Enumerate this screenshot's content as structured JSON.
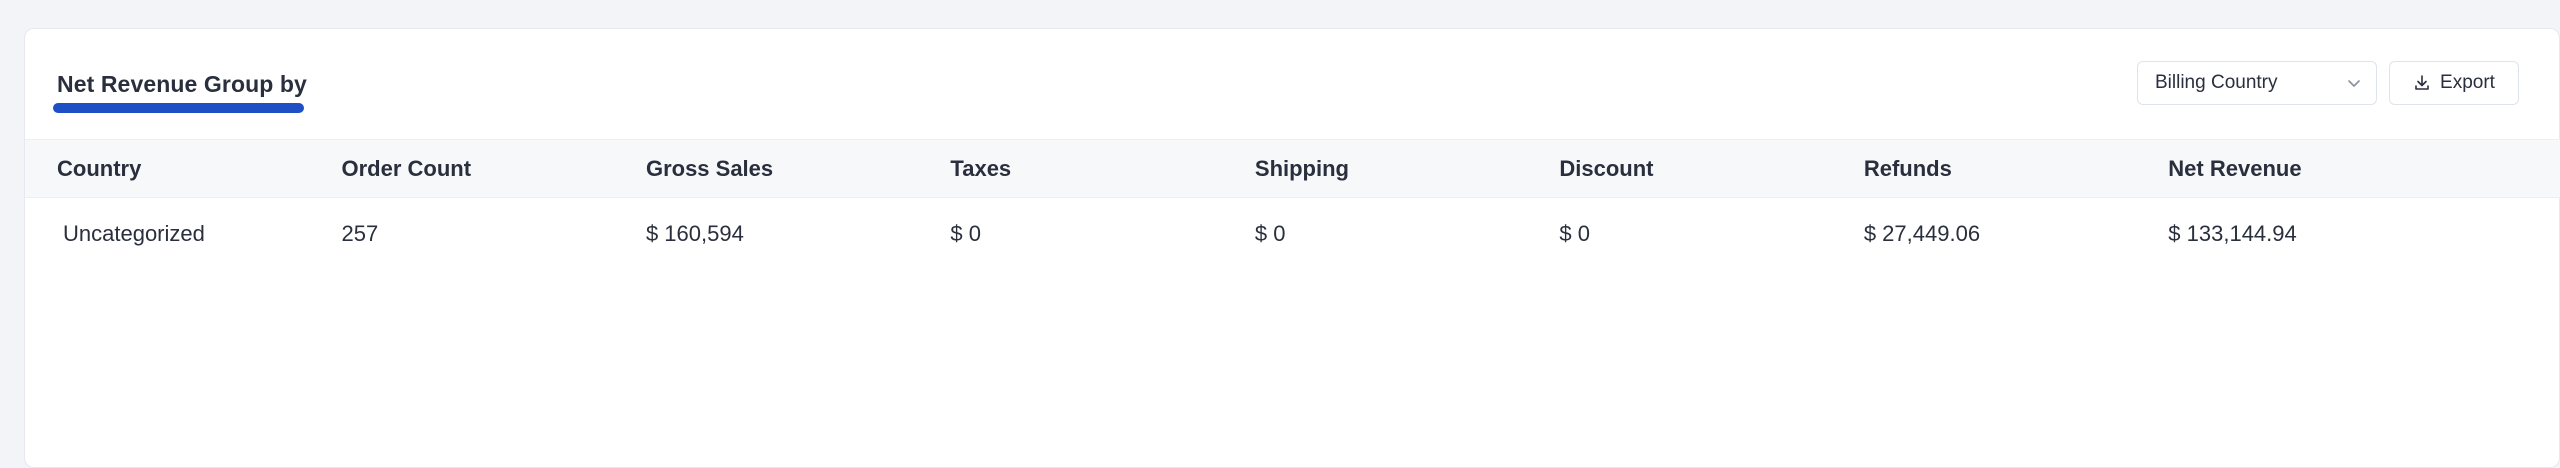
{
  "report": {
    "title": "Net Revenue Group by",
    "accent_color": "#1f4fc4"
  },
  "controls": {
    "group_by_selected": "Billing Country",
    "group_by_icon": "chevron-down-icon",
    "export_label": "Export",
    "export_icon": "download-icon"
  },
  "table": {
    "columns": [
      "Country",
      "Order Count",
      "Gross Sales",
      "Taxes",
      "Shipping",
      "Discount",
      "Refunds",
      "Net Revenue"
    ],
    "rows": [
      [
        "Uncategorized",
        "257",
        "$ 160,594",
        "$ 0",
        "$ 0",
        "$ 0",
        "$ 27,449.06",
        "$ 133,144.94"
      ]
    ]
  }
}
